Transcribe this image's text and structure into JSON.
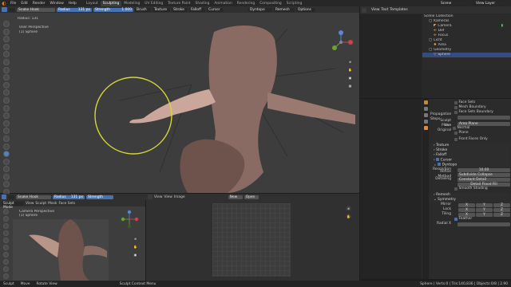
{
  "menu": [
    "File",
    "Edit",
    "Render",
    "Window",
    "Help"
  ],
  "workspaces": [
    "Layout",
    "Sculpting",
    "Modeling",
    "UV Editing",
    "Texture Paint",
    "Shading",
    "Animation",
    "Rendering",
    "Compositing",
    "Scripting"
  ],
  "active_workspace": "Sculpting",
  "scene_label": "Scene",
  "view_layer_label": "View Layer",
  "top_tool": {
    "brush_name": "Snake Hook",
    "radius_label": "Radius",
    "radius_value": "131 px",
    "strength_label": "Strength",
    "strength_value": "1.000",
    "menus": [
      "Brush",
      "Texture",
      "Stroke",
      "Falloff",
      "Cursor"
    ],
    "dyntopo": "Dyntopo",
    "remesh": "Remesh",
    "options": "Options"
  },
  "viewport": {
    "radius_readout": "Radius: 131",
    "view_name": "User Perspective",
    "object_name": "(1) Sphere"
  },
  "bottom_tool": {
    "brush_name": "Snake Hook",
    "radius_label": "Radius",
    "radius_value": "131 px",
    "strength_label": "Strength",
    "mode": "Sculpt Mode",
    "menus": [
      "View",
      "Sculpt",
      "Mask",
      "Face Sets"
    ]
  },
  "camera_view": {
    "view_name": "Camera Perspective",
    "object_name": "(1) Sphere"
  },
  "image_editor": {
    "menus": [
      "View",
      "View",
      "Image"
    ],
    "new_label": "New",
    "open_label": "Open"
  },
  "outliner": {
    "header_menus": [
      "View",
      "Text",
      "Templates"
    ],
    "items": [
      {
        "label": "Scene Collection",
        "indent": 0
      },
      {
        "label": "Kameras",
        "indent": 1
      },
      {
        "label": "Camera",
        "indent": 2
      },
      {
        "label": "Dof",
        "indent": 2
      },
      {
        "label": "Focus",
        "indent": 2
      },
      {
        "label": "Licht",
        "indent": 1
      },
      {
        "label": "Area",
        "indent": 2
      },
      {
        "label": "Geometry",
        "indent": 1
      },
      {
        "label": "Sphere",
        "indent": 2
      }
    ]
  },
  "properties": {
    "face_sets": "Face Sets",
    "mesh_boundary": "Mesh Boundary",
    "face_sets_boundary": "Face Sets Boundary",
    "propagation_steps": "Propagation Steps",
    "sculpt_plane_label": "Sculpt Plane",
    "sculpt_plane_value": "Area Plane",
    "use_original_label": "Use Original",
    "normal": "Normal",
    "plane": "Plane",
    "front_faces_only": "Front Faces Only",
    "texture": "Texture",
    "stroke": "Stroke",
    "falloff": "Falloff",
    "cursor": "Cursor",
    "dyntopo": "Dyntopo",
    "resolution_label": "Resolution",
    "resolution_value": "10.00",
    "refine_label": "Refine Method",
    "refine_value": "Subdivide Collapse",
    "detailing_label": "Detailing",
    "detailing_value": "Constant Detail",
    "detail_flood_fill": "Detail Flood Fill",
    "smooth_shading": "Smooth Shading",
    "remesh": "Remesh",
    "symmetry": "Symmetry",
    "mirror_label": "Mirror",
    "lock_label": "Lock",
    "tiling_label": "Tiling",
    "axes": [
      "X",
      "Y",
      "Z"
    ],
    "feather": "Feather",
    "radial_label": "Radial X"
  },
  "status": {
    "left": [
      "Sculpt",
      "Move",
      "Rotate View"
    ],
    "center": "Sculpt Context Menu",
    "right": "Sphere | Verts:0 | Tris:140,836 | Objects:0/8 | 2.90"
  },
  "colors": {
    "accent": "#4772b3",
    "brush_circle": "#d6d63a",
    "sculpt": "#8a6b63"
  },
  "icons": {
    "tool_icons": [
      "draw",
      "draw-sharp",
      "clay",
      "clay-strips",
      "clay-thumb",
      "layer",
      "inflate",
      "blob",
      "crease",
      "smooth",
      "flatten",
      "fill",
      "scrape",
      "multiplane-scrape",
      "pinch",
      "grab",
      "elastic-deform",
      "snake-hook",
      "thumb",
      "pose",
      "nudge",
      "rotate",
      "slide-relax",
      "boundary",
      "cloth",
      "simplify",
      "mask",
      "box-mask",
      "box-face-set",
      "box-trim",
      "line-project",
      "mesh-filter",
      "cloth-filter",
      "color-filter",
      "edit-face-set",
      "mask-by-color",
      "transform",
      "annotate"
    ]
  }
}
